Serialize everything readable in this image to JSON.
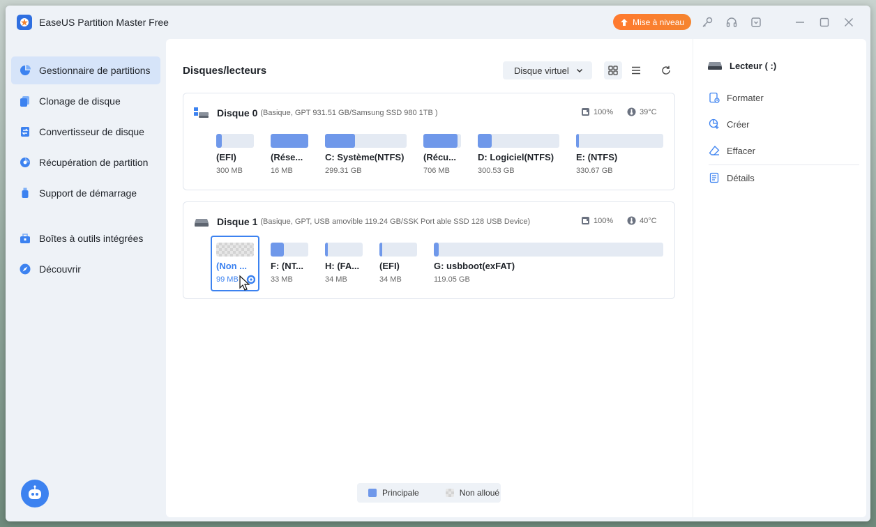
{
  "app": {
    "title": "EaseUS Partition Master Free",
    "upgrade_label": "Mise à niveau"
  },
  "sidebar": {
    "items": [
      {
        "label": "Gestionnaire de partitions",
        "icon": "pie-chart-icon"
      },
      {
        "label": "Clonage de disque",
        "icon": "clone-icon"
      },
      {
        "label": "Convertisseur de disque",
        "icon": "convert-icon"
      },
      {
        "label": "Récupération de partition",
        "icon": "recovery-icon"
      },
      {
        "label": "Support de démarrage",
        "icon": "usb-icon"
      },
      {
        "label": "Boîtes à outils intégrées",
        "icon": "toolbox-icon"
      },
      {
        "label": "Découvrir",
        "icon": "compass-icon"
      }
    ]
  },
  "main": {
    "title": "Disques/lecteurs",
    "virtual_disk_label": "Disque virtuel",
    "disks": [
      {
        "name": "Disque 0",
        "info": "(Basique, GPT 931.51 GB/Samsung SSD 980 1TB )",
        "health": "100%",
        "temp": "39°C",
        "partitions": [
          {
            "label": "(EFI)",
            "size": "300 MB",
            "used": 0.15
          },
          {
            "label": "(Rése...",
            "size": "16 MB",
            "used": 1.0
          },
          {
            "label": "C: Système(NTFS)",
            "size": "299.31 GB",
            "used": 0.37
          },
          {
            "label": "(Récu...",
            "size": "706 MB",
            "used": 0.9
          },
          {
            "label": "D: Logiciel(NTFS)",
            "size": "300.53 GB",
            "used": 0.17
          },
          {
            "label": "E: (NTFS)",
            "size": "330.67 GB",
            "used": 0.03
          }
        ]
      },
      {
        "name": "Disque 1",
        "info": "(Basique, GPT, USB amovible 119.24 GB/SSK Port able SSD 128      USB Device)",
        "health": "100%",
        "temp": "40°C",
        "partitions": [
          {
            "label": "(Non ...",
            "size": "99 MB",
            "used": 0,
            "unallocated": true
          },
          {
            "label": "F: (NT...",
            "size": "33 MB",
            "used": 0.35
          },
          {
            "label": "H: (FA...",
            "size": "34 MB",
            "used": 0.07
          },
          {
            "label": "(EFI)",
            "size": "34 MB",
            "used": 0.07
          },
          {
            "label": "G: usbboot(exFAT)",
            "size": "119.05 GB",
            "used": 0.02
          }
        ]
      }
    ],
    "legend": {
      "primary": "Principale",
      "unallocated": "Non alloué"
    }
  },
  "right_panel": {
    "title": "Lecteur ( :)",
    "actions": [
      "Formater",
      "Créer",
      "Effacer"
    ],
    "details": "Détails"
  },
  "colors": {
    "accent": "#3c82f0",
    "partition_fill": "#6f98ea",
    "upgrade": "#ff7a2f"
  }
}
